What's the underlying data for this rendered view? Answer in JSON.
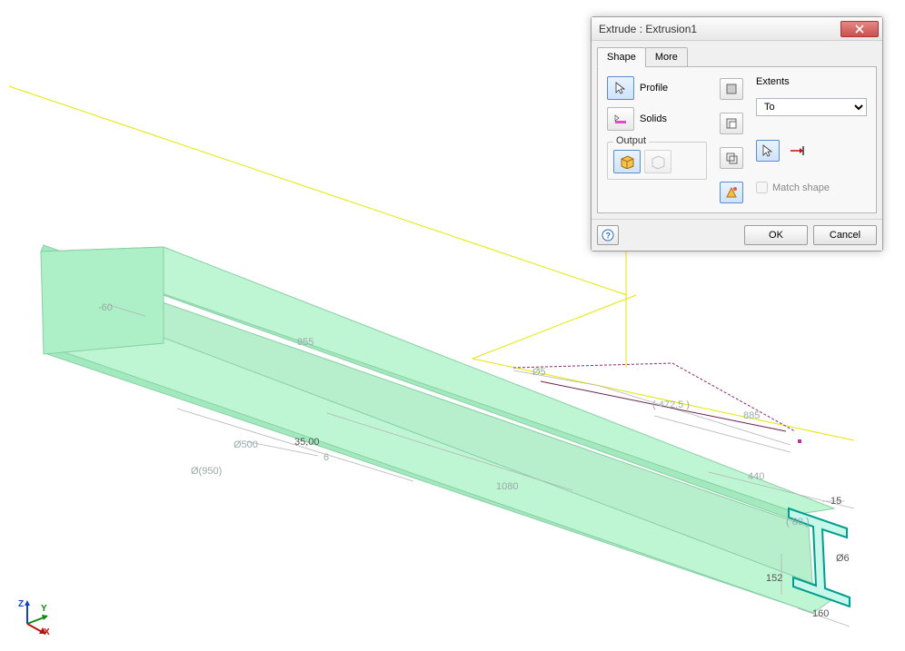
{
  "dialog": {
    "title": "Extrude : Extrusion1",
    "tabs": {
      "shape": "Shape",
      "more": "More"
    },
    "profile_label": "Profile",
    "solids_label": "Solids",
    "output_group": "Output",
    "extents_group": "Extents",
    "extents_value": "To",
    "match_shape": "Match shape",
    "ok": "OK",
    "cancel": "Cancel"
  },
  "dims": {
    "d60": "-60",
    "d955": "955",
    "d0500": "Ø500",
    "d35": "35,00",
    "d0950": "Ø(950)",
    "d05": "Ø5",
    "d4725": "( 472,5 )",
    "d885": "885",
    "d440": "440",
    "d1080": "1080",
    "d15": "15",
    "d80": "( 80 )",
    "d06": "Ø6",
    "d152": "152",
    "d160": "160",
    "d6": "6"
  },
  "axes": {
    "x": "X",
    "y": "Y",
    "z": "Z"
  }
}
